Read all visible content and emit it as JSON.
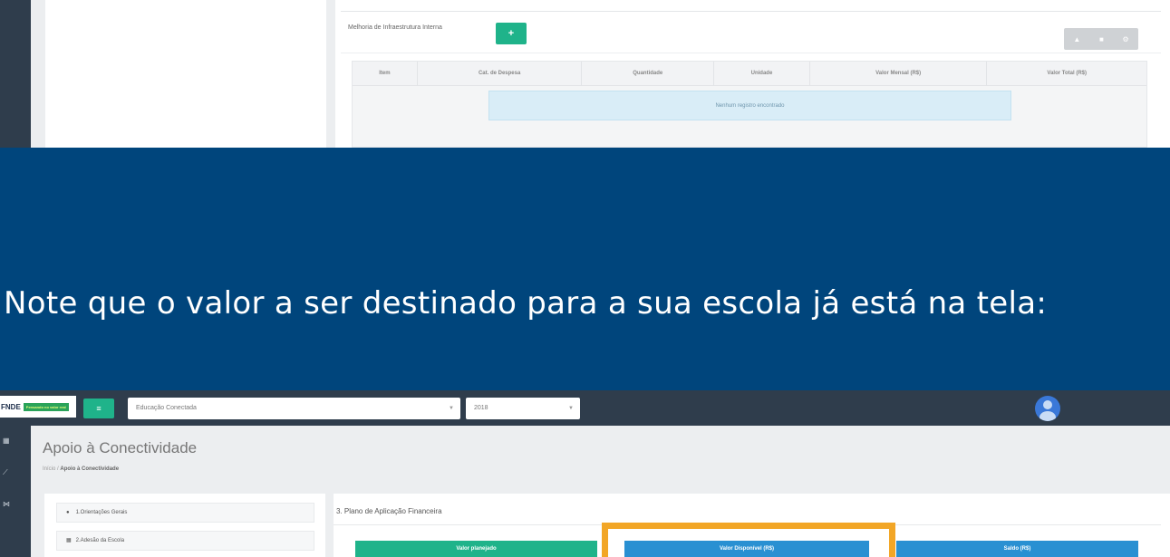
{
  "top_section": {
    "section_title": "Melhoria de Infraestrutura Interna",
    "add_button_label": "+",
    "tool_buttons": [
      "▲",
      "■",
      "⚙"
    ],
    "table_columns": [
      "Item",
      "Cat. de Despesa",
      "Quantidade",
      "Unidade",
      "Valor Mensal (R$)",
      "Valor Total (R$)"
    ],
    "empty_message": "Nenhum registro encontrado"
  },
  "banner": {
    "text": "Note que o valor a ser destinado para a sua escola já está na tela:"
  },
  "bottom_section": {
    "logo": {
      "name": "FNDE",
      "tagline": "Pensando no valor real"
    },
    "menu_button_label": "≡",
    "program_select": {
      "value": "Educação Conectada"
    },
    "year_select": {
      "value": "2018"
    },
    "page_title": "Apoio à Conectividade",
    "breadcrumb": {
      "home": "Início",
      "separator": "/",
      "current": "Apoio à Conectividade"
    },
    "nav_items": [
      {
        "label": "1.Orientações Gerais",
        "icon": "●"
      },
      {
        "label": "2.Adesão da Escola",
        "icon": "▦"
      }
    ],
    "plan_title": "3. Plano de Aplicação Financeira",
    "stats": [
      "Valor planejado",
      "Valor Disponível (R$)",
      "Saldo (R$)"
    ]
  },
  "colors": {
    "banner": "#00457c",
    "accent_green": "#1fb38a",
    "accent_blue": "#2990d2",
    "highlight": "#f2a626",
    "sidebar": "#2f3d4c"
  }
}
